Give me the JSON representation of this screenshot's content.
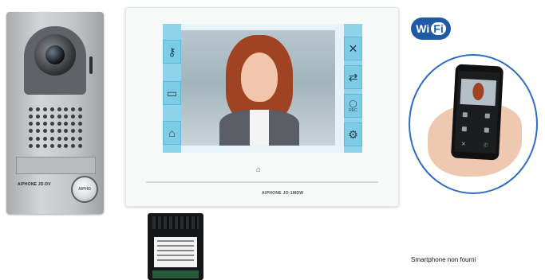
{
  "door_station": {
    "brand": "AIPHONE JD-DV",
    "call_button_label": "AIPHO"
  },
  "monitor": {
    "model": "AIPHONE JO-1MDW",
    "left_buttons": [
      "key-icon",
      "gate-icon",
      "garage-icon"
    ],
    "right_buttons": [
      "close-icon",
      "transfer-icon",
      "rec-icon",
      "settings-icon"
    ],
    "rec_label": "REC",
    "home_icon": "home-icon"
  },
  "wifi_badge": {
    "wi": "Wi",
    "fi": "Fi"
  },
  "caption": "Smartphone non fourni",
  "colors": {
    "screen_accent": "#8fd3ea",
    "wifi_blue": "#1f5aa6",
    "circle_blue": "#2c6cc1"
  }
}
